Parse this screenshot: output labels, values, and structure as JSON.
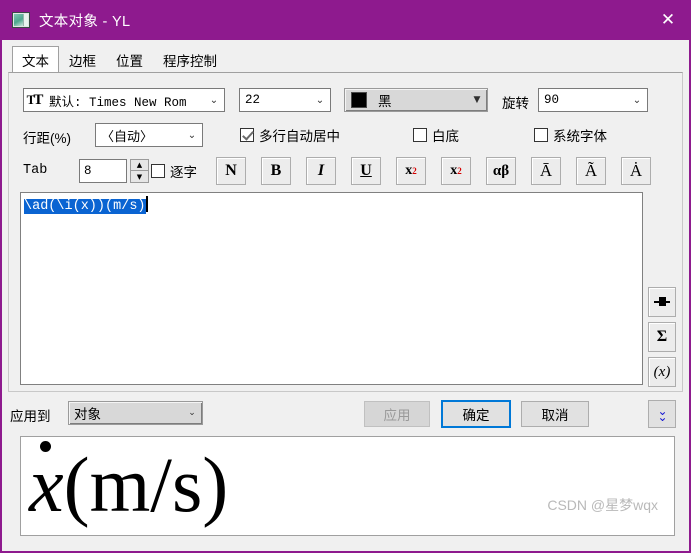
{
  "window": {
    "title": "文本对象 - YL",
    "icon": "window-image-icon",
    "close_label": "✕",
    "titlebar_color": "#8E1A8E"
  },
  "tabs": [
    {
      "label": "文本",
      "active": true
    },
    {
      "label": "边框",
      "active": false
    },
    {
      "label": "位置",
      "active": false
    },
    {
      "label": "程序控制",
      "active": false
    }
  ],
  "text_tab": {
    "font_combo": {
      "icon": "tt-font-icon",
      "value": "默认: Times New Rom"
    },
    "size_combo": {
      "value": "22"
    },
    "color_combo": {
      "value": "黑",
      "swatch": "#000000"
    },
    "rotation": {
      "label": "旋转",
      "value": "90"
    },
    "line_spacing": {
      "label": "行距(%)",
      "value": "〈自动〉"
    },
    "multiline_center": {
      "label": "多行自动居中",
      "checked": true
    },
    "white_background": {
      "label": "白底",
      "checked": false
    },
    "system_font": {
      "label": "系统字体",
      "checked": false
    },
    "tab": {
      "label": "Tab",
      "value": "8"
    },
    "per_char": {
      "label": "逐字",
      "checked": false
    },
    "format_buttons": [
      {
        "name": "normal-button",
        "glyph": "N",
        "style": "normal"
      },
      {
        "name": "bold-button",
        "glyph": "B",
        "style": "bold"
      },
      {
        "name": "italic-button",
        "glyph": "I",
        "style": "italic"
      },
      {
        "name": "underline-button",
        "glyph": "U",
        "style": "underline"
      },
      {
        "name": "superscript-button",
        "glyph": "x",
        "mark": "2",
        "style": "sup"
      },
      {
        "name": "subscript-button",
        "glyph": "x",
        "mark": "2",
        "style": "sub"
      },
      {
        "name": "greek-button",
        "glyph": "αβ",
        "style": "normal"
      },
      {
        "name": "macron-accent-button",
        "glyph": "Ā",
        "style": "normal"
      },
      {
        "name": "tilde-accent-button",
        "glyph": "Ã",
        "style": "normal"
      },
      {
        "name": "dot-accent-button",
        "glyph": "Ȧ",
        "style": "normal"
      }
    ],
    "editor": {
      "text": "\\ad(\\i(x))(m/s)",
      "selected": true
    },
    "side_buttons": [
      {
        "name": "insert-field-button",
        "glyph": ""
      },
      {
        "name": "sigma-button",
        "glyph": "Σ"
      },
      {
        "name": "function-button",
        "glyph": "(x)"
      }
    ]
  },
  "bottom_bar": {
    "apply_to_label": "应用到",
    "apply_to_value": "对象",
    "apply_button": "应用",
    "ok_button": "确定",
    "cancel_button": "取消",
    "expand_button": "ˇˇ",
    "accent_color": "#0078D7"
  },
  "preview": {
    "glyph_x": "x",
    "rest": "(m/s)",
    "accent": "dot-above"
  },
  "watermark": "CSDN @星梦wqx"
}
